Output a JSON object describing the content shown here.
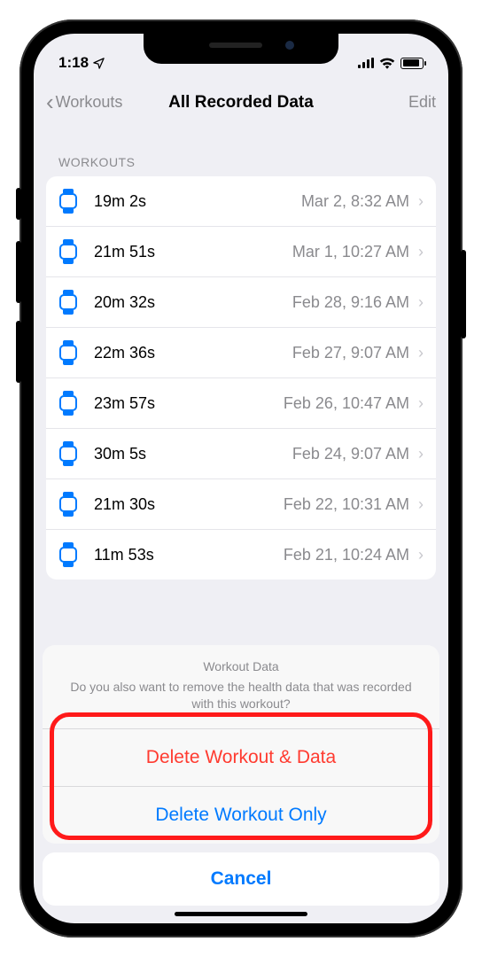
{
  "status": {
    "time": "1:18",
    "location_icon": "◤"
  },
  "nav": {
    "back_label": "Workouts",
    "title": "All Recorded Data",
    "edit_label": "Edit"
  },
  "section_header": "WORKOUTS",
  "workouts": [
    {
      "duration": "19m 2s",
      "date": "Mar 2, 8:32 AM"
    },
    {
      "duration": "21m 51s",
      "date": "Mar 1, 10:27 AM"
    },
    {
      "duration": "20m 32s",
      "date": "Feb 28, 9:16 AM"
    },
    {
      "duration": "22m 36s",
      "date": "Feb 27, 9:07 AM"
    },
    {
      "duration": "23m 57s",
      "date": "Feb 26, 10:47 AM"
    },
    {
      "duration": "30m 5s",
      "date": "Feb 24, 9:07 AM"
    },
    {
      "duration": "21m 30s",
      "date": "Feb 22, 10:31 AM"
    },
    {
      "duration": "11m 53s",
      "date": "Feb 21, 10:24 AM"
    }
  ],
  "action_sheet": {
    "title": "Workout Data",
    "message": "Do you also want to remove the health data that was recorded with this workout?",
    "delete_all": "Delete Workout & Data",
    "delete_only": "Delete Workout Only",
    "cancel": "Cancel"
  }
}
